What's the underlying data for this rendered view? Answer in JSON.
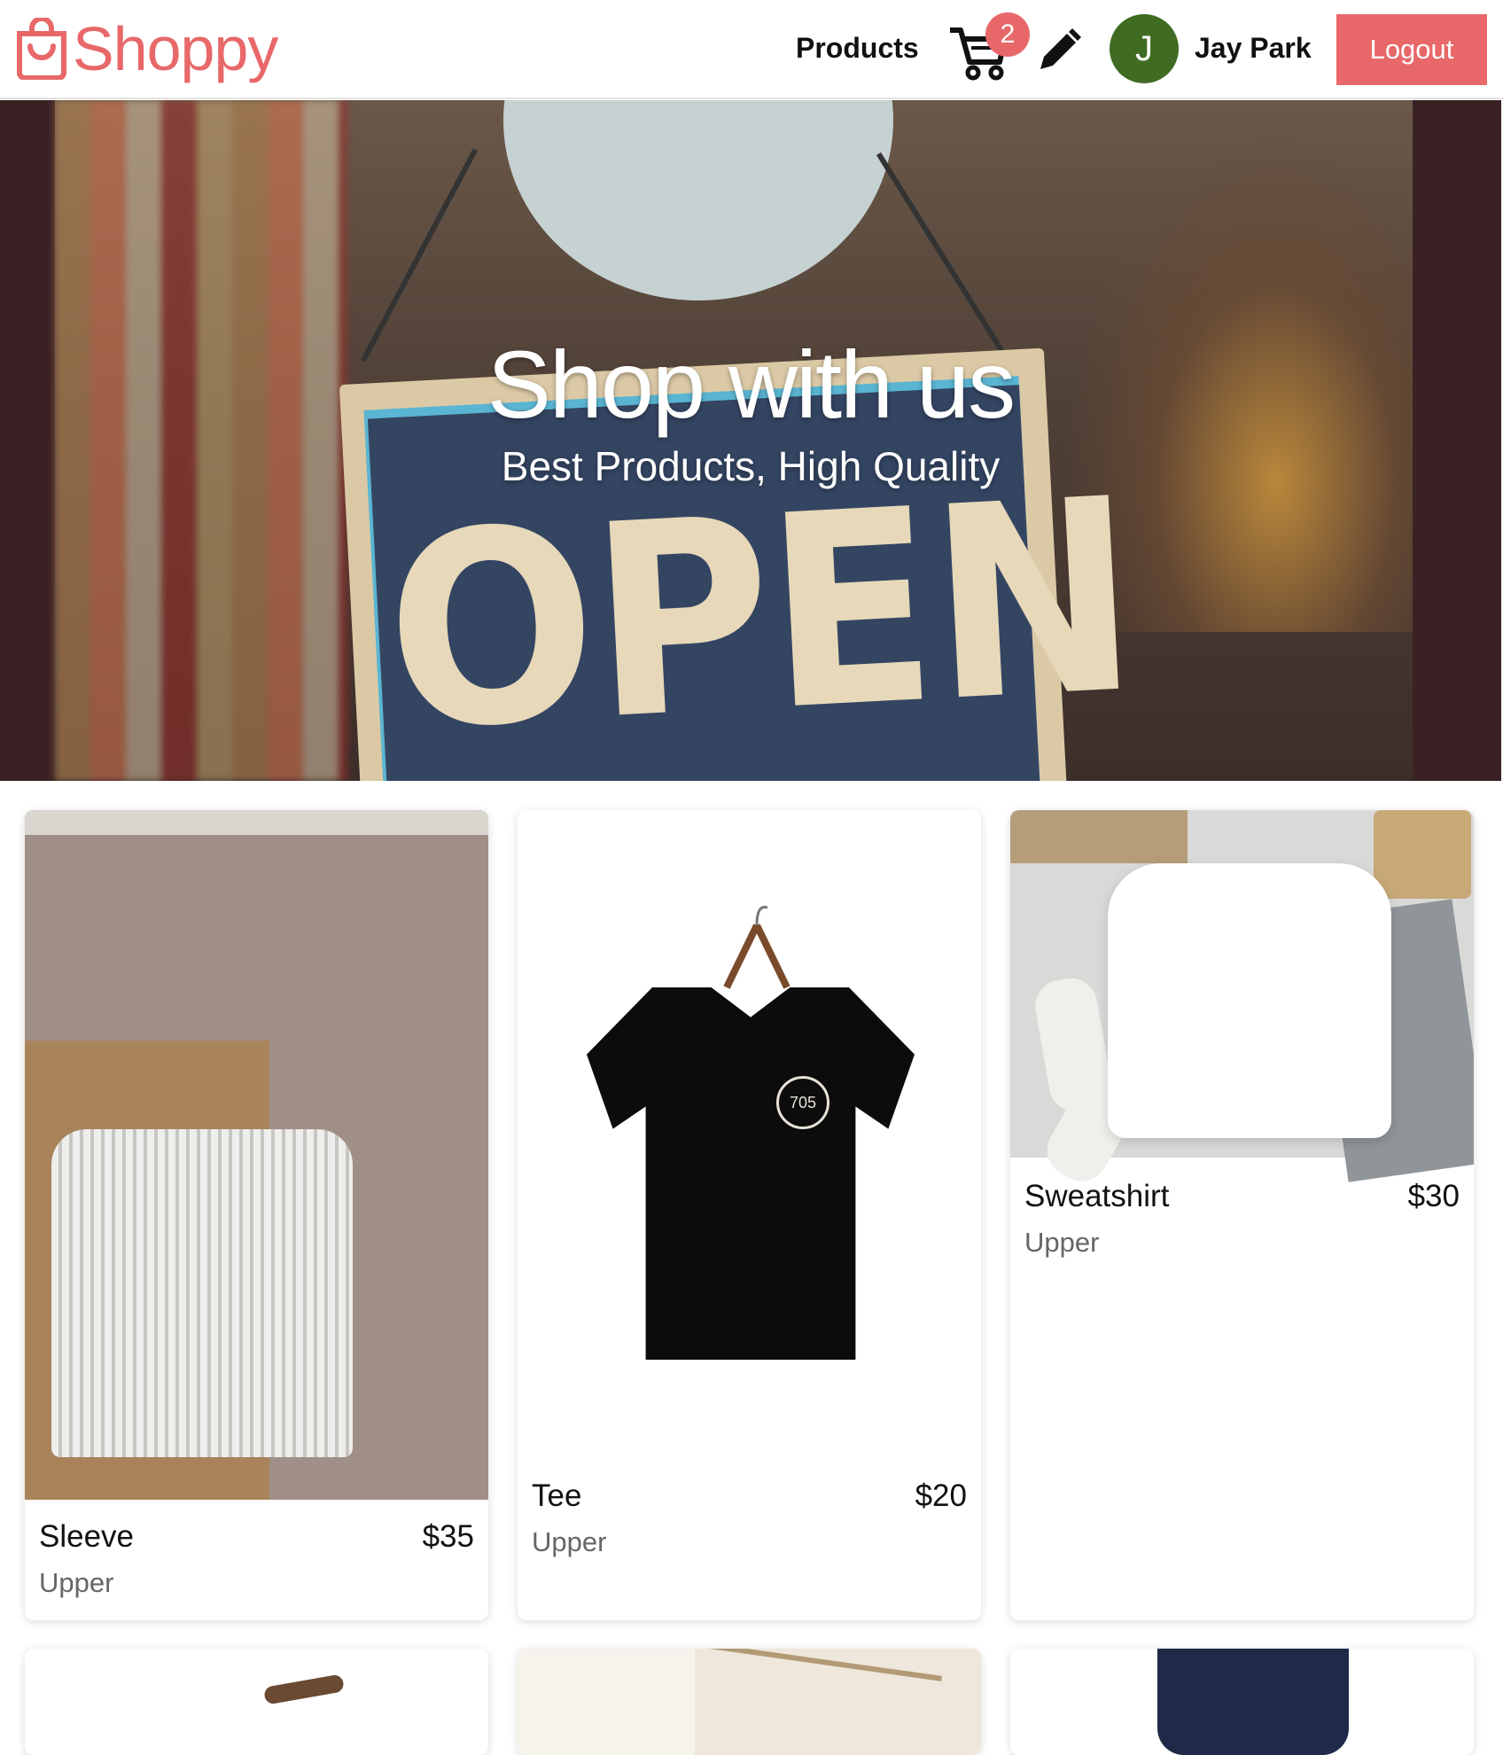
{
  "header": {
    "brand": "Shoppy",
    "nav_products": "Products",
    "cart_count": "2",
    "user_initial": "J",
    "user_name": "Jay Park",
    "logout_label": "Logout",
    "accent_color": "#e8686a",
    "avatar_color": "#3f6b23"
  },
  "hero": {
    "title": "Shop with us",
    "subtitle": "Best Products, High Quality",
    "sign_text": "OPEN"
  },
  "products": [
    {
      "name": "Sleeve",
      "price": "$35",
      "category": "Upper"
    },
    {
      "name": "Tee",
      "price": "$20",
      "category": "Upper"
    },
    {
      "name": "Sweatshirt",
      "price": "$30",
      "category": "Upper"
    }
  ],
  "tee_logo_text": "705",
  "icons": {
    "logo": "shopping-bag-icon",
    "cart": "cart-icon",
    "edit": "pencil-icon"
  }
}
